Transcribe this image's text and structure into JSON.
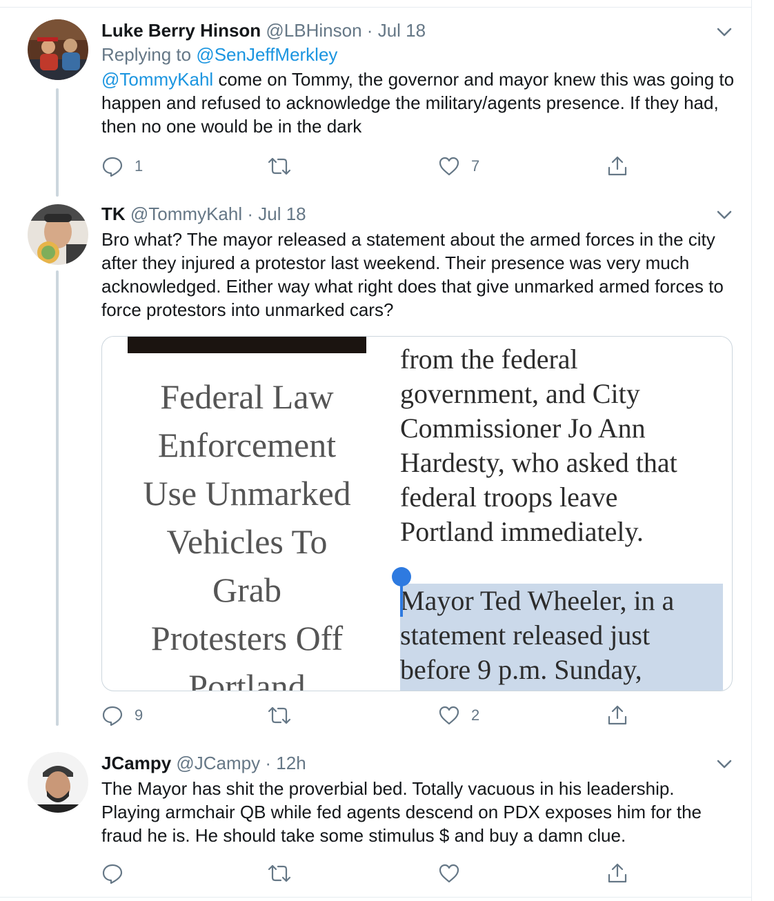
{
  "tweets": [
    {
      "name": "Luke Berry Hinson",
      "handle": "@LBHinson",
      "separator": "·",
      "time": "Jul 18",
      "replying_prefix": "Replying to",
      "replying_to": "@SenJeffMerkley",
      "mention": "@TommyKahl",
      "text": " come on Tommy, the governor and mayor knew this was going to happen and refused to acknowledge the military/agents presence. If they had, then no one would be in the dark",
      "replies": "1",
      "retweets": "",
      "likes": "7"
    },
    {
      "name": "TK",
      "handle": "@TommyKahl",
      "separator": "·",
      "time": "Jul 18",
      "text": "Bro what? The mayor released a statement about the armed forces in the city after they injured a protestor last weekend. Their presence was very much acknowledged. Either way what right does that give unmarked armed forces to force protestors into unmarked cars?",
      "replies": "9",
      "retweets": "",
      "likes": "2",
      "media": {
        "left_lines": [
          "Federal Law",
          "Enforcement",
          "Use Unmarked",
          "Vehicles To",
          "Grab",
          "Protesters Off",
          "Portland"
        ],
        "right_lines": [
          "from the federal",
          "government, and City",
          "Commissioner Jo Ann",
          "Hardesty, who asked that",
          "federal troops leave",
          "Portland immediately."
        ],
        "highlight_lines": [
          "Mayor Ted Wheeler, in a",
          "statement released just",
          "before 9 p.m. Sunday,"
        ]
      }
    },
    {
      "name": "JCampy",
      "handle": "@JCampy",
      "separator": "·",
      "time": "12h",
      "text": "The Mayor has shit the proverbial bed. Totally vacuous in his leadership. Playing armchair QB while fed agents descend on PDX exposes him for the fraud he is. He should take some stimulus $ and buy a damn clue.",
      "replies": "",
      "retweets": "",
      "likes": ""
    }
  ],
  "colors": {
    "link": "#1b95e0",
    "muted": "#657786",
    "text": "#14171a",
    "border": "#ccd6dd",
    "selection": "#cbd9ea"
  },
  "icons": [
    "reply-icon",
    "retweet-icon",
    "like-icon",
    "share-icon",
    "chevron-down-icon"
  ]
}
